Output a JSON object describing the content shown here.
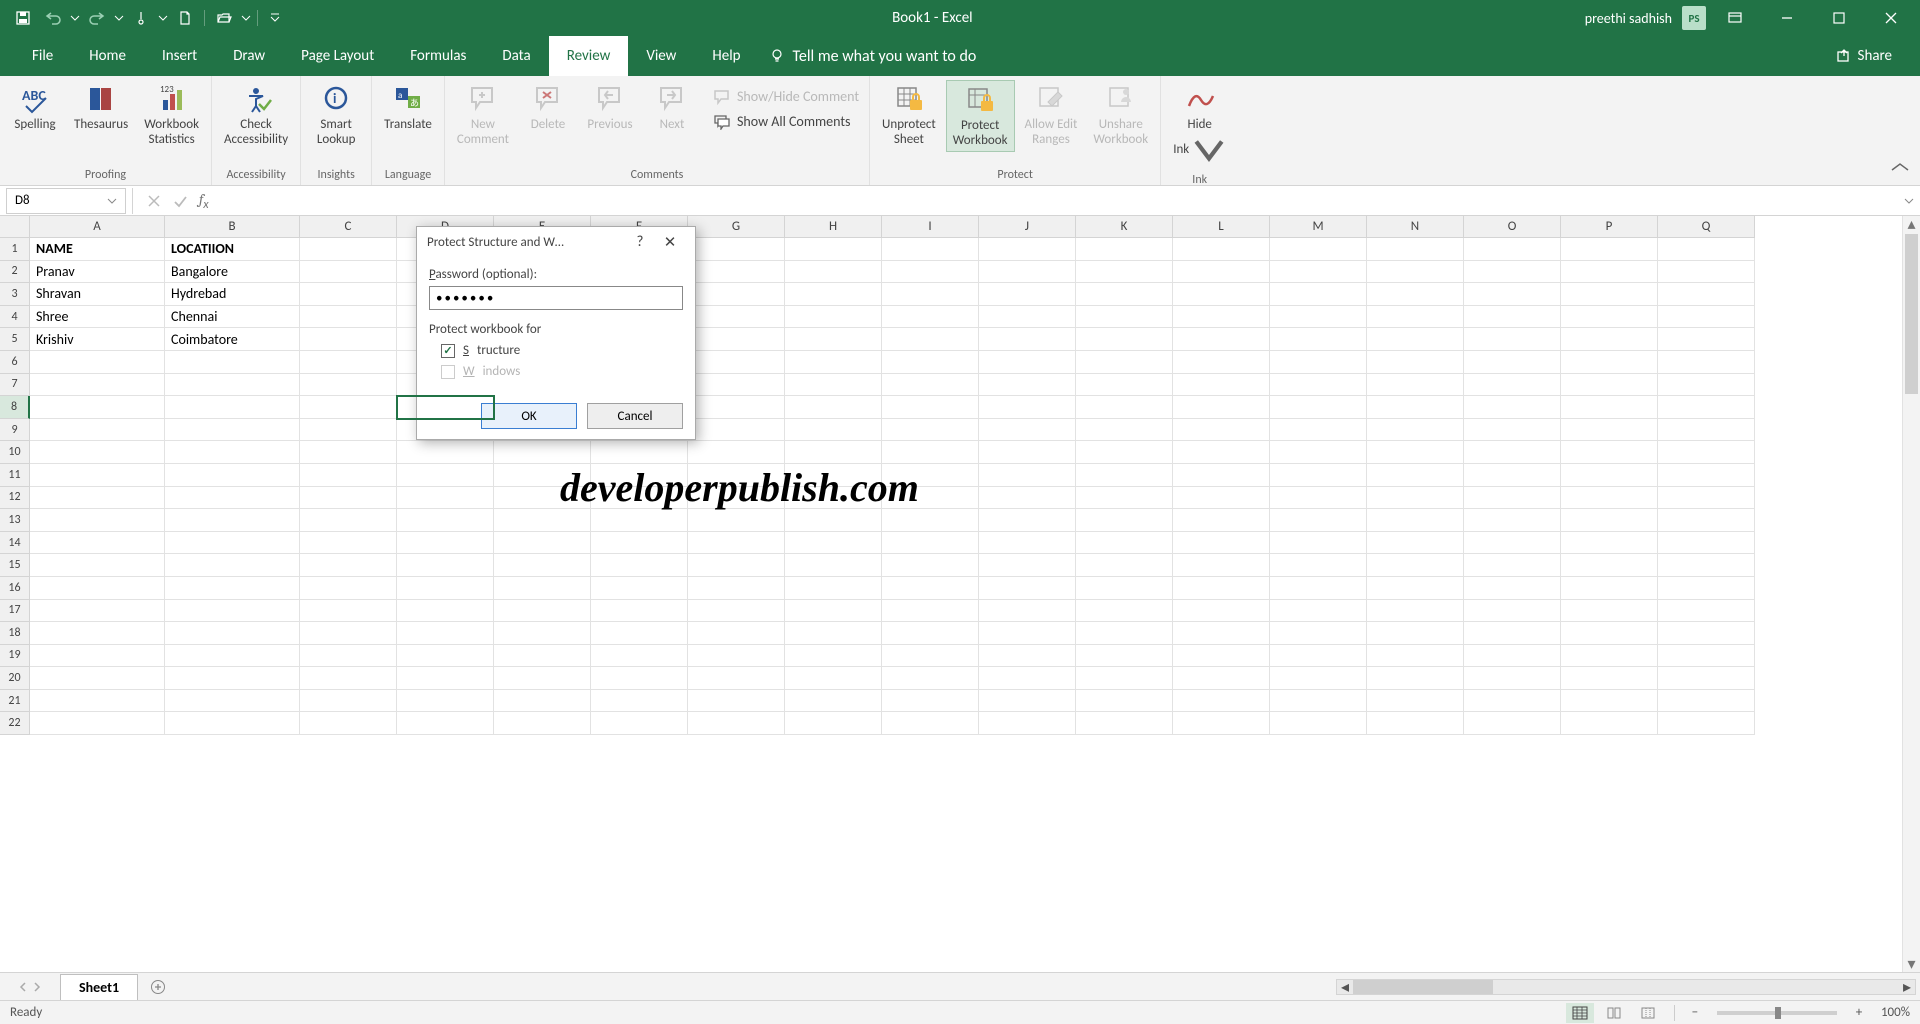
{
  "title": {
    "doc": "Book1",
    "sep": "  -  ",
    "app": "Excel"
  },
  "user": {
    "name": "preethi sadhish",
    "initials": "PS"
  },
  "menu": [
    "File",
    "Home",
    "Insert",
    "Draw",
    "Page Layout",
    "Formulas",
    "Data",
    "Review",
    "View",
    "Help"
  ],
  "menu_active": "Review",
  "tell_me": "Tell me what you want to do",
  "share": "Share",
  "ribbon": {
    "proofing": {
      "label": "Proofing",
      "spelling": "Spelling",
      "thesaurus": "Thesaurus",
      "stats1": "Workbook",
      "stats2": "Statistics"
    },
    "access": {
      "label": "Accessibility",
      "check1": "Check",
      "check2": "Accessibility"
    },
    "insights": {
      "label": "Insights",
      "smart1": "Smart",
      "smart2": "Lookup"
    },
    "lang": {
      "label": "Language",
      "translate": "Translate"
    },
    "comments": {
      "label": "Comments",
      "new1": "New",
      "new2": "Comment",
      "delete": "Delete",
      "prev": "Previous",
      "next": "Next",
      "showhide": "Show/Hide Comment",
      "showall": "Show All Comments"
    },
    "protect": {
      "label": "Protect",
      "unprotect1": "Unprotect",
      "unprotect2": "Sheet",
      "protectwb1": "Protect",
      "protectwb2": "Workbook",
      "allow1": "Allow Edit",
      "allow2": "Ranges",
      "unshare1": "Unshare",
      "unshare2": "Workbook"
    },
    "ink": {
      "label": "Ink",
      "hide1": "Hide",
      "hide2": "Ink"
    }
  },
  "namebox": "D8",
  "columns": [
    "A",
    "B",
    "C",
    "D",
    "E",
    "F",
    "G",
    "H",
    "I",
    "J",
    "K",
    "L",
    "M",
    "N",
    "O",
    "P",
    "Q"
  ],
  "row_count": 22,
  "active_row": 8,
  "cells": {
    "A1": "NAME",
    "B1": "LOCATIION",
    "A2": "Pranav",
    "B2": "Bangalore",
    "A3": "Shravan",
    "B3": "Hydrebad",
    "A4": "Shree",
    "B4": "Chennai",
    "A5": "Krishiv",
    "B5": "Coimbatore"
  },
  "bold_cells": [
    "A1",
    "B1"
  ],
  "active_cell": "D8",
  "watermark": "developerpublish.com",
  "sheet": {
    "name": "Sheet1"
  },
  "status": {
    "ready": "Ready",
    "zoom": "100%"
  },
  "dialog": {
    "title": "Protect Structure and W…",
    "pw_label": "Password (optional):",
    "pw_value": "•••••••",
    "section": "Protect workbook for",
    "opt_structure": "Structure",
    "opt_windows": "Windows",
    "ok": "OK",
    "cancel": "Cancel"
  }
}
